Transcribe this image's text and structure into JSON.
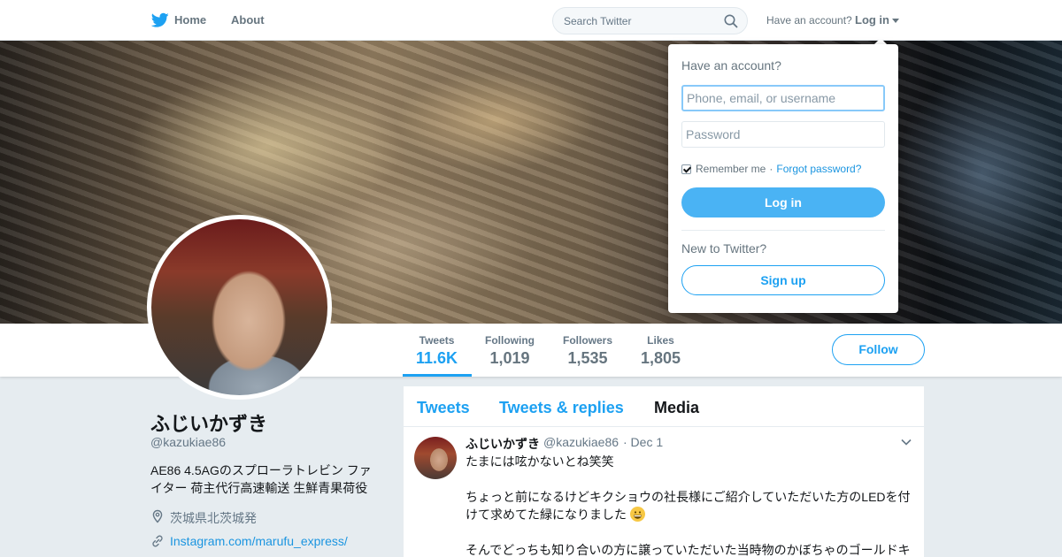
{
  "nav": {
    "home_label": "Home",
    "about_label": "About",
    "search_placeholder": "Search Twitter",
    "have_account": "Have an account?",
    "login_label": "Log in",
    "brand_color": "#1da1f2"
  },
  "profile": {
    "name": "ふじいかずき",
    "handle": "@kazukiae86",
    "bio": "AE86 4.5AGのスプローラトレビン ファイター 荷主代行高速輸送 生鮮青果荷役",
    "location": "茨城県北茨城発",
    "link": "Instagram.com/marufu_express/"
  },
  "stats": [
    {
      "label": "Tweets",
      "value": "11.6K",
      "active": true
    },
    {
      "label": "Following",
      "value": "1,019",
      "active": false
    },
    {
      "label": "Followers",
      "value": "1,535",
      "active": false
    },
    {
      "label": "Likes",
      "value": "1,805",
      "active": false
    }
  ],
  "follow_label": "Follow",
  "timeline": {
    "tabs": [
      "Tweets",
      "Tweets & replies",
      "Media"
    ],
    "current_tab": "Media",
    "tweet": {
      "name": "ふじいかずき",
      "handle": "@kazukiae86",
      "date": "· Dec 1",
      "line1": "たまには呟かないとね笑笑",
      "line2": "ちょっと前になるけどキクショウの社長様にご紹介していただいた方のLEDを付けて求めてた緑になりました",
      "line3": "そんでどっちも知り合いの方に譲っていただいた当時物のかぼちゃのゴールドキ",
      "emoji": "grinning-face"
    }
  },
  "login_dropdown": {
    "title": "Have an account?",
    "username_placeholder": "Phone, email, or username",
    "password_placeholder": "Password",
    "remember_label": "Remember me",
    "separator": "·",
    "forgot_label": "Forgot password?",
    "login_button": "Log in",
    "new_label": "New to Twitter?",
    "signup_button": "Sign up"
  }
}
